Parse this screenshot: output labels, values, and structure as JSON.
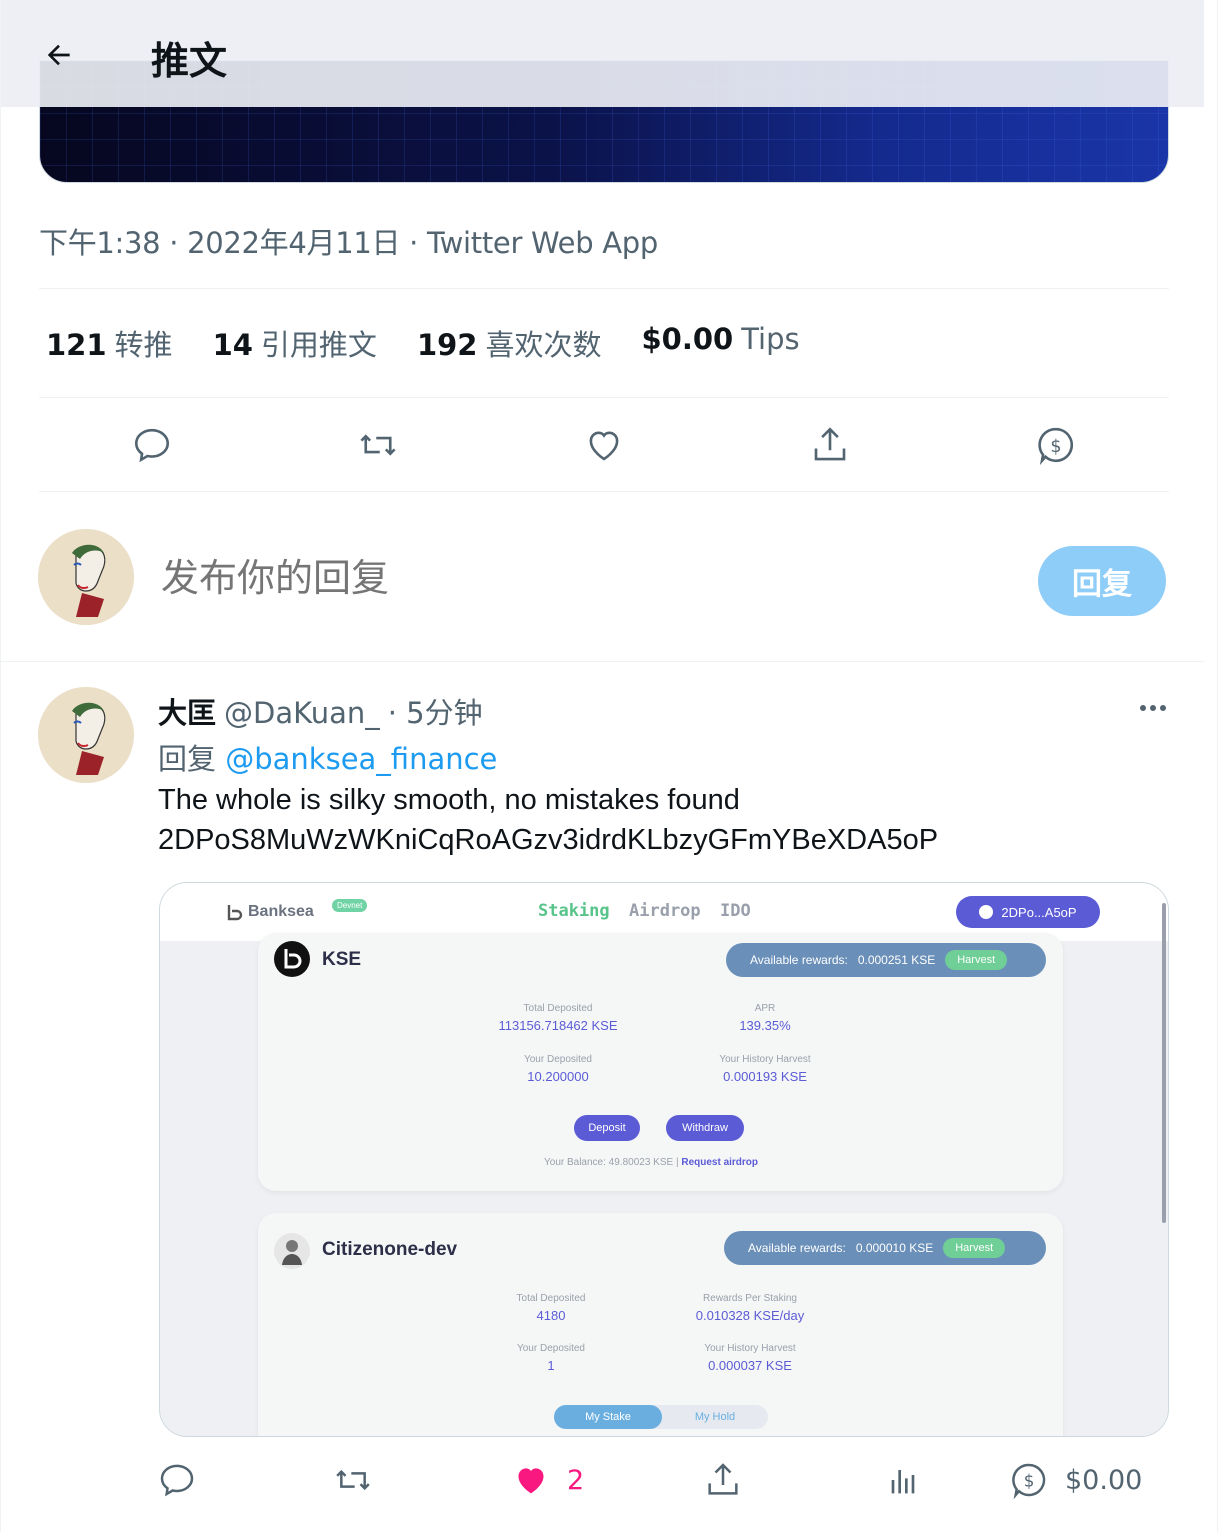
{
  "header": {
    "title": "推文",
    "back_icon": "arrow-left-icon"
  },
  "tweet": {
    "meta": "下午1:38 · 2022年4月11日 · Twitter Web App",
    "stats": [
      {
        "num": "121",
        "label": "转推"
      },
      {
        "num": "14",
        "label": "引用推文"
      },
      {
        "num": "192",
        "label": "喜欢次数"
      },
      {
        "num": "$0.00",
        "label": "Tips"
      }
    ]
  },
  "compose": {
    "placeholder": "发布你的回复",
    "button": "回复"
  },
  "reply": {
    "name": "大匡",
    "handle": "@DaKuan_",
    "time": "· 5分钟",
    "replying_prefix": "回复",
    "replying_to": "@banksea_finance",
    "text_line1": "The whole is silky smooth, no mistakes found",
    "text_line2": "2DPoS8MuWzWKniCqRoAGzv3idrdKLbzyGFmYBeXDA5oP",
    "like_count": "2",
    "tip_amount": "$0.00"
  },
  "screenshot": {
    "logo": "Banksea",
    "devnet": "Devnet",
    "tabs": [
      "Staking",
      "Airdrop",
      "IDO"
    ],
    "wallet": "2DPo...A5oP",
    "card1": {
      "title": "KSE",
      "rewards_label": "Available rewards:",
      "rewards_value": "0.000251 KSE",
      "harvest": "Harvest",
      "total_deposited_k": "Total Deposited",
      "total_deposited_v": "113156.718462 KSE",
      "apr_k": "APR",
      "apr_v": "139.35%",
      "your_deposited_k": "Your Deposited",
      "your_deposited_v": "10.200000",
      "history_k": "Your History Harvest",
      "history_v": "0.000193 KSE",
      "deposit": "Deposit",
      "withdraw": "Withdraw",
      "balance": "Your Balance: 49.80023 KSE |",
      "request": "Request airdrop"
    },
    "card2": {
      "title": "Citizenone-dev",
      "rewards_label": "Available rewards:",
      "rewards_value": "0.000010 KSE",
      "harvest": "Harvest",
      "total_deposited_k": "Total Deposited",
      "total_deposited_v": "4180",
      "rps_k": "Rewards Per Staking",
      "rps_v": "0.010328 KSE/day",
      "your_deposited_k": "Your Deposited",
      "your_deposited_v": "1",
      "history_k": "Your History Harvest",
      "history_v": "0.000037 KSE",
      "my_stake": "My Stake",
      "my_hold": "My Hold"
    }
  },
  "colors": {
    "accent": "#1d9bf0",
    "like": "#f91880",
    "muted": "#536471",
    "button_disabled": "#8ecdf8"
  }
}
